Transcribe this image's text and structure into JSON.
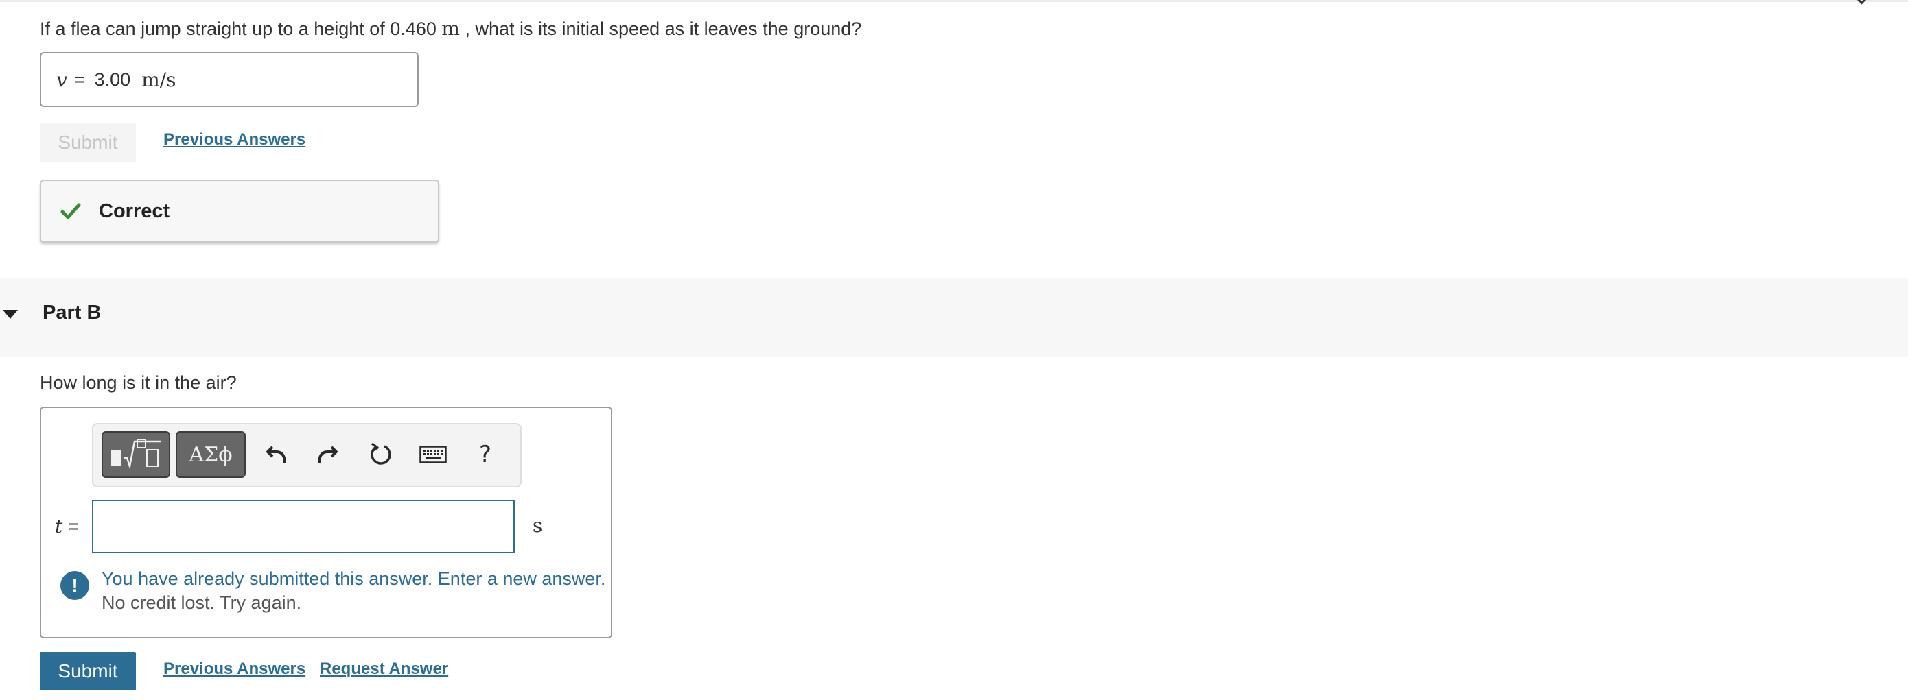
{
  "part_a": {
    "question_before": "If a flea can jump straight up to a height of 0.460 ",
    "question_unit": "m",
    "question_after": " , what is its initial speed as it leaves the ground?",
    "answer_var": "v",
    "answer_eq": "=",
    "answer_value": "3.00",
    "answer_unit": "m/s",
    "submit_label": "Submit",
    "previous_answers_label": "Previous Answers",
    "feedback": "Correct"
  },
  "part_b": {
    "title": "Part B",
    "question": "How long is it in the air?",
    "toolbar": {
      "symbols_label": "ΑΣϕ",
      "help_label": "?",
      "icons": [
        "templates-icon",
        "undo-icon",
        "redo-icon",
        "reset-icon",
        "keyboard-icon"
      ]
    },
    "answer_var": "t",
    "answer_eq": "=",
    "answer_value": "",
    "answer_unit": "s",
    "notice_line1": "You have already submitted this answer. Enter a new answer.",
    "notice_line2": "No credit lost. Try again.",
    "notice_icon": "!",
    "submit_label": "Submit",
    "previous_answers_label": "Previous Answers",
    "request_answer_label": "Request Answer"
  },
  "colors": {
    "accent": "#2b6d94",
    "correct_check": "#3a8a3a",
    "toolbar_button": "#676767"
  }
}
